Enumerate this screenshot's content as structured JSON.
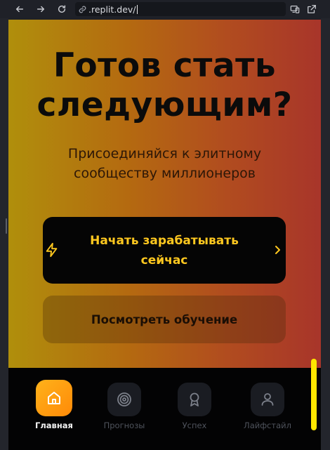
{
  "browser": {
    "url": ".replit.dev/"
  },
  "hero": {
    "title_line1": "Готов стать",
    "title_line2": "следующим?",
    "subtitle_line1": "Присоединяйся к элитному",
    "subtitle_line2": "сообществу миллионеров"
  },
  "cta": {
    "primary_line1": "Начать зарабатывать",
    "primary_line2": "сейчас",
    "secondary": "Посмотреть обучение"
  },
  "bottom_nav": {
    "items": [
      {
        "label": "Главная",
        "icon": "home-icon",
        "active": true
      },
      {
        "label": "Прогнозы",
        "icon": "target-icon",
        "active": false
      },
      {
        "label": "Успех",
        "icon": "award-icon",
        "active": false
      },
      {
        "label": "Лайфстайл",
        "icon": "user-icon",
        "active": false
      }
    ]
  },
  "colors": {
    "accent": "#ffc81f",
    "active_nav": "#ff9d12",
    "scrollbar": "#ffe600"
  }
}
